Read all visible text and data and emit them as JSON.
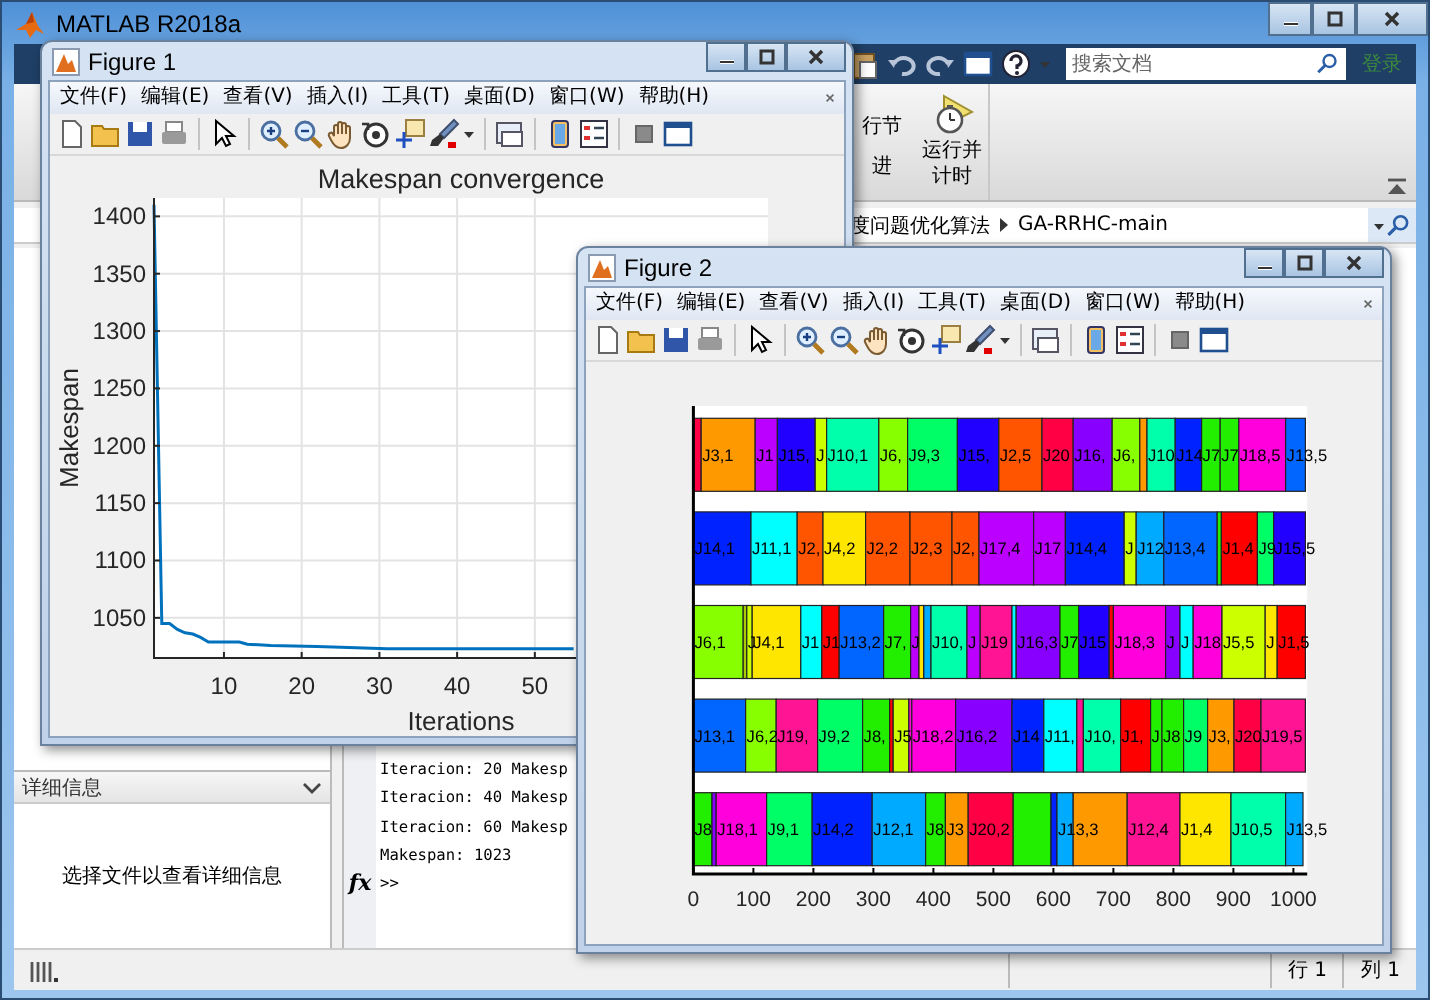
{
  "app": {
    "title": "MATLAB R2018a"
  },
  "search": {
    "placeholder": "搜索文档"
  },
  "sign_in": "登录",
  "ribbon": {
    "cut_labels": [
      "行节",
      "进"
    ],
    "run_and_time": "运行并计时"
  },
  "address": {
    "path": [
      "度问题优化算法",
      "GA-RRHC-main"
    ]
  },
  "details": {
    "title": "详细信息",
    "message": "选择文件以查看详细信息"
  },
  "command_window": {
    "function_hint": "fx",
    "lines": [
      "Iteracion: 20 Makesp",
      "Iteracion: 40 Makesp",
      "Iteracion: 60 Makesp",
      "Makespan: 1023"
    ],
    "prompt": ">>"
  },
  "status_bar": {
    "row": "行 1",
    "column": "列 1"
  },
  "figures": [
    {
      "title": "Figure 1",
      "menu": [
        "文件(F)",
        "编辑(E)",
        "查看(V)",
        "插入(I)",
        "工具(T)",
        "桌面(D)",
        "窗口(W)",
        "帮助(H)"
      ],
      "chart_data": {
        "type": "line",
        "title": "Makespan convergence",
        "xlabel": "Iterations",
        "ylabel": "Makespan",
        "grid": true,
        "xlim": [
          1,
          80
        ],
        "ylim": [
          1015,
          1416
        ],
        "xticks": [
          10,
          20,
          30,
          40,
          50
        ],
        "yticks": [
          1050,
          1100,
          1150,
          1200,
          1250,
          1300,
          1350,
          1400
        ],
        "x": [
          1,
          2,
          3,
          4,
          5,
          6,
          7,
          8,
          12,
          13,
          16,
          22,
          31,
          55
        ],
        "series": [
          {
            "color": "#0072bd",
            "values": [
              1410,
              1045,
              1045,
              1040,
              1037,
              1036,
              1033,
              1029,
              1029,
              1027,
              1026,
              1025,
              1023,
              1023
            ]
          }
        ]
      }
    },
    {
      "title": "Figure 2",
      "menu": [
        "文件(F)",
        "编辑(E)",
        "查看(V)",
        "插入(I)",
        "工具(T)",
        "桌面(D)",
        "窗口(W)",
        "帮助(H)"
      ],
      "chart_data": {
        "type": "bar",
        "orientation": "horizontal",
        "stacked": true,
        "categories": [
          null,
          null,
          null,
          null,
          null
        ],
        "xlim": [
          0,
          1023
        ],
        "xticks": [
          0,
          100,
          200,
          300,
          400,
          500,
          600,
          700,
          800,
          900,
          1000
        ],
        "series": [
          {
            "color": "#ff0044",
            "values": [
              13,
              null,
              null,
              null,
              null
            ]
          },
          {
            "name": "J3,1",
            "color": "#ff9900",
            "values": [
              90,
              null,
              null,
              null,
              null
            ]
          },
          {
            "name": "J1",
            "color": "#bb00ff",
            "values": [
              37,
              null,
              null,
              null,
              null
            ]
          },
          {
            "name": "J15,",
            "color": "#2200ff",
            "values": [
              63,
              null,
              null,
              null,
              null
            ]
          },
          {
            "name": "J",
            "color": "#ccff00",
            "values": [
              19,
              null,
              null,
              null,
              null
            ]
          },
          {
            "name": "J10,1",
            "color": "#00ffaa",
            "values": [
              87,
              null,
              null,
              null,
              null
            ]
          },
          {
            "name": "J6,",
            "color": "#88ff00",
            "values": [
              48,
              null,
              null,
              null,
              null
            ]
          },
          {
            "name": "J9,3",
            "color": "#00ff66",
            "values": [
              83,
              null,
              null,
              null,
              null
            ]
          },
          {
            "name": "J15,",
            "color": "#2200ff",
            "values": [
              69,
              null,
              null,
              null,
              null
            ]
          },
          {
            "name": "J2,5",
            "color": "#ff5500",
            "values": [
              72,
              null,
              null,
              null,
              null
            ]
          },
          {
            "name": "J20",
            "color": "#ff0044",
            "values": [
              52,
              null,
              null,
              null,
              null
            ]
          },
          {
            "name": "J16,",
            "color": "#8800ff",
            "values": [
              65,
              null,
              null,
              null,
              null
            ]
          },
          {
            "name": "J6,",
            "color": "#88ff00",
            "values": [
              46,
              null,
              null,
              null,
              null
            ]
          },
          {
            "color": "#ff9900",
            "values": [
              12,
              null,
              null,
              null,
              null
            ]
          },
          {
            "name": "J10",
            "color": "#00ffaa",
            "values": [
              47,
              null,
              null,
              null,
              null
            ]
          },
          {
            "name": "J14",
            "color": "#0022ff",
            "values": [
              44,
              null,
              null,
              null,
              null
            ]
          },
          {
            "name": "J7",
            "color": "#22ee00",
            "values": [
              31,
              null,
              null,
              null,
              null
            ]
          },
          {
            "name": "J7",
            "color": "#22ee00",
            "values": [
              31,
              null,
              null,
              null,
              null
            ]
          },
          {
            "name": "J18,5",
            "color": "#ff00dd",
            "values": [
              78,
              null,
              null,
              null,
              null
            ]
          },
          {
            "name": "J13,5",
            "color": "#0066ff",
            "values": [
              33,
              null,
              null,
              null,
              null
            ]
          },
          {
            "name": "J14,1",
            "color": "#0022ff",
            "values": [
              null,
              96,
              null,
              null,
              null
            ]
          },
          {
            "name": "J11,1",
            "color": "#00ffff",
            "values": [
              null,
              77,
              null,
              null,
              null
            ]
          },
          {
            "name": "J2,",
            "color": "#ff5500",
            "values": [
              null,
              43,
              null,
              null,
              null
            ]
          },
          {
            "name": "J4,2",
            "color": "#ffe600",
            "values": [
              null,
              71,
              null,
              null,
              null
            ]
          },
          {
            "name": "J2,2",
            "color": "#ff5500",
            "values": [
              null,
              74,
              null,
              null,
              null
            ]
          },
          {
            "name": "J2,3",
            "color": "#ff5500",
            "values": [
              null,
              70,
              null,
              null,
              null
            ]
          },
          {
            "name": "J2,",
            "color": "#ff5500",
            "values": [
              null,
              45,
              null,
              null,
              null
            ]
          },
          {
            "name": "J17,4",
            "color": "#bb00ff",
            "values": [
              null,
              91,
              null,
              null,
              null
            ]
          },
          {
            "name": "J17",
            "color": "#bb00ff",
            "values": [
              null,
              53,
              null,
              null,
              null
            ]
          },
          {
            "name": "J14,4",
            "color": "#0022ff",
            "values": [
              null,
              98,
              null,
              null,
              null
            ]
          },
          {
            "name": "J",
            "color": "#ccff00",
            "values": [
              null,
              20,
              null,
              null,
              null
            ]
          },
          {
            "name": "J12",
            "color": "#00aaff",
            "values": [
              null,
              46,
              null,
              null,
              null
            ]
          },
          {
            "name": "J13,4",
            "color": "#0066ff",
            "values": [
              null,
              89,
              null,
              null,
              null
            ]
          },
          {
            "color": "#22ee00",
            "values": [
              null,
              7,
              null,
              null,
              null
            ]
          },
          {
            "name": "J1,4",
            "color": "#ff0000",
            "values": [
              null,
              60,
              null,
              null,
              null
            ]
          },
          {
            "name": "J9",
            "color": "#00ff66",
            "values": [
              null,
              27,
              null,
              null,
              null
            ]
          },
          {
            "name": "J15,5",
            "color": "#2200ff",
            "values": [
              null,
              53,
              null,
              null,
              null
            ]
          },
          {
            "name": "J6,1",
            "color": "#88ff00",
            "values": [
              null,
              null,
              83,
              null,
              null
            ]
          },
          {
            "color": "#aacc00",
            "values": [
              null,
              null,
              6,
              null,
              null
            ]
          },
          {
            "name": "J",
            "color": "#ccff00",
            "values": [
              null,
              null,
              9,
              null,
              null
            ]
          },
          {
            "name": "J4,1",
            "color": "#ffe600",
            "values": [
              null,
              null,
              81,
              null,
              null
            ]
          },
          {
            "name": "J1",
            "color": "#00ffff",
            "values": [
              null,
              null,
              35,
              null,
              null
            ]
          },
          {
            "name": "J1",
            "color": "#ff0000",
            "values": [
              null,
              null,
              29,
              null,
              null
            ]
          },
          {
            "name": "J13,2",
            "color": "#0066ff",
            "values": [
              null,
              null,
              74,
              null,
              null
            ]
          },
          {
            "name": "J7,",
            "color": "#22ee00",
            "values": [
              null,
              null,
              45,
              null,
              null
            ]
          },
          {
            "name": "J",
            "color": "#bb00ff",
            "values": [
              null,
              null,
              14,
              null,
              null
            ]
          },
          {
            "color": "#ffe600",
            "values": [
              null,
              null,
              8,
              null,
              null
            ]
          },
          {
            "color": "#00aaff",
            "values": [
              null,
              null,
              12,
              null,
              null
            ]
          },
          {
            "name": "J10,",
            "color": "#00ffaa",
            "values": [
              null,
              null,
              60,
              null,
              null
            ]
          },
          {
            "name": "J",
            "color": "#bb00ff",
            "values": [
              null,
              null,
              22,
              null,
              null
            ]
          },
          {
            "name": "J19",
            "color": "#ff1493",
            "values": [
              null,
              null,
              53,
              null,
              null
            ]
          },
          {
            "color": "#00ffff",
            "values": [
              null,
              null,
              7,
              null,
              null
            ]
          },
          {
            "name": "J16,3",
            "color": "#8800ff",
            "values": [
              null,
              null,
              73,
              null,
              null
            ]
          },
          {
            "name": "J7",
            "color": "#22ee00",
            "values": [
              null,
              null,
              31,
              null,
              null
            ]
          },
          {
            "name": "J15",
            "color": "#2200ff",
            "values": [
              null,
              null,
              51,
              null,
              null
            ]
          },
          {
            "color": "#ff0000",
            "values": [
              null,
              null,
              7,
              null,
              null
            ]
          },
          {
            "name": "J18,3",
            "color": "#ff00dd",
            "values": [
              null,
              null,
              87,
              null,
              null
            ]
          },
          {
            "name": "J",
            "color": "#8800ff",
            "values": [
              null,
              null,
              24,
              null,
              null
            ]
          },
          {
            "name": "J",
            "color": "#00ffff",
            "values": [
              null,
              null,
              22,
              null,
              null
            ]
          },
          {
            "name": "J18",
            "color": "#ff00dd",
            "values": [
              null,
              null,
              48,
              null,
              null
            ]
          },
          {
            "name": "J5,5",
            "color": "#ccff00",
            "values": [
              null,
              null,
              72,
              null,
              null
            ]
          },
          {
            "name": "J",
            "color": "#ffe600",
            "values": [
              null,
              null,
              20,
              null,
              null
            ]
          },
          {
            "name": "J1,5",
            "color": "#ff0000",
            "values": [
              null,
              null,
              47,
              null,
              null
            ]
          },
          {
            "name": "J13,1",
            "color": "#0066ff",
            "values": [
              null,
              null,
              null,
              87,
              null
            ]
          },
          {
            "name": "J6,2",
            "color": "#88ff00",
            "values": [
              null,
              null,
              null,
              51,
              null
            ]
          },
          {
            "name": "J19,",
            "color": "#ff1493",
            "values": [
              null,
              null,
              null,
              69,
              null
            ]
          },
          {
            "name": "J9,2",
            "color": "#00ff66",
            "values": [
              null,
              null,
              null,
              75,
              null
            ]
          },
          {
            "name": "J8,",
            "color": "#22ee00",
            "values": [
              null,
              null,
              null,
              45,
              null
            ]
          },
          {
            "color": "#ff0000",
            "values": [
              null,
              null,
              null,
              6,
              null
            ]
          },
          {
            "name": "J5",
            "color": "#ccff00",
            "values": [
              null,
              null,
              null,
              26,
              null
            ]
          },
          {
            "color": "#ff00dd",
            "values": [
              null,
              null,
              null,
              5,
              null
            ]
          },
          {
            "name": "J18,2",
            "color": "#ff00dd",
            "values": [
              null,
              null,
              null,
              73,
              null
            ]
          },
          {
            "name": "J16,2",
            "color": "#8800ff",
            "values": [
              null,
              null,
              null,
              94,
              null
            ]
          },
          {
            "name": "J14",
            "color": "#0022ff",
            "values": [
              null,
              null,
              null,
              53,
              null
            ]
          },
          {
            "name": "J11,",
            "color": "#00ffff",
            "values": [
              null,
              null,
              null,
              55,
              null
            ]
          },
          {
            "color": "#ff1493",
            "values": [
              null,
              null,
              null,
              11,
              null
            ]
          },
          {
            "name": "J10,",
            "color": "#00ffaa",
            "values": [
              null,
              null,
              null,
              62,
              null
            ]
          },
          {
            "name": "J1,",
            "color": "#ff0000",
            "values": [
              null,
              null,
              null,
              50,
              null
            ]
          },
          {
            "name": "J",
            "color": "#22ee00",
            "values": [
              null,
              null,
              null,
              19,
              null
            ]
          },
          {
            "name": "J8",
            "color": "#22ee00",
            "values": [
              null,
              null,
              null,
              36,
              null
            ]
          },
          {
            "name": "J9",
            "color": "#00ff66",
            "values": [
              null,
              null,
              null,
              40,
              null
            ]
          },
          {
            "name": "J3,",
            "color": "#ff9900",
            "values": [
              null,
              null,
              null,
              44,
              null
            ]
          },
          {
            "name": "J20",
            "color": "#ff0044",
            "values": [
              null,
              null,
              null,
              45,
              null
            ]
          },
          {
            "name": "J19,5",
            "color": "#ff1493",
            "values": [
              null,
              null,
              null,
              74,
              null
            ]
          },
          {
            "name": "J8",
            "color": "#22ee00",
            "values": [
              null,
              null,
              null,
              null,
              31
            ]
          },
          {
            "color": "#8800ff",
            "values": [
              null,
              null,
              null,
              null,
              7
            ]
          },
          {
            "name": "J18,1",
            "color": "#ff00dd",
            "values": [
              null,
              null,
              null,
              null,
              84
            ]
          },
          {
            "name": "J9,1",
            "color": "#00ff66",
            "values": [
              null,
              null,
              null,
              null,
              76
            ]
          },
          {
            "name": "J14,2",
            "color": "#0022ff",
            "values": [
              null,
              null,
              null,
              null,
              100
            ]
          },
          {
            "name": "J12,1",
            "color": "#00aaff",
            "values": [
              null,
              null,
              null,
              null,
              89
            ]
          },
          {
            "name": "J8",
            "color": "#22ee00",
            "values": [
              null,
              null,
              null,
              null,
              33
            ]
          },
          {
            "name": "J3",
            "color": "#ff9900",
            "values": [
              null,
              null,
              null,
              null,
              38
            ]
          },
          {
            "name": "J20,2",
            "color": "#ff0044",
            "values": [
              null,
              null,
              null,
              null,
              75
            ]
          },
          {
            "color": "#22ee00",
            "values": [
              null,
              null,
              null,
              null,
              63
            ]
          },
          {
            "color": "#0022ff",
            "values": [
              null,
              null,
              null,
              null,
              10
            ]
          },
          {
            "name": "J13,3",
            "color": "#00aaff",
            "values": [
              null,
              null,
              null,
              null,
              27
            ]
          },
          {
            "color": "#ff9900",
            "values": [
              null,
              null,
              null,
              null,
              90
            ]
          },
          {
            "name": "J12,4",
            "color": "#ff1493",
            "values": [
              null,
              null,
              null,
              null,
              88
            ]
          },
          {
            "name": "J1,4",
            "color": "#ffe600",
            "values": [
              null,
              null,
              null,
              null,
              85
            ]
          },
          {
            "name": "J10,5",
            "color": "#00ffaa",
            "values": [
              null,
              null,
              null,
              null,
              91
            ]
          },
          {
            "name": "J13,5",
            "color": "#00aaff",
            "values": [
              null,
              null,
              null,
              null,
              29
            ]
          }
        ]
      }
    }
  ]
}
